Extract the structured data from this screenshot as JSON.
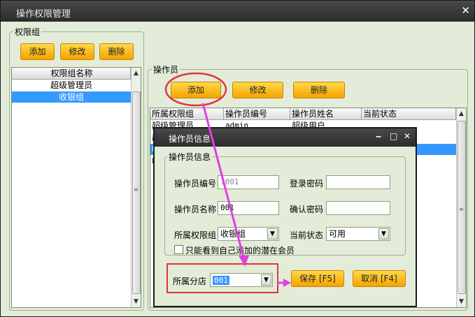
{
  "window": {
    "title": "操作权限管理",
    "close_glyph": "✕"
  },
  "perm_group": {
    "label": "权限组",
    "buttons": {
      "add": "添加",
      "edit": "修改",
      "delete": "删除"
    },
    "column": "权限组名称",
    "rows": [
      "超级管理员",
      "收银组"
    ],
    "selected_index": 1
  },
  "operator": {
    "label": "操作员",
    "buttons": {
      "add": "添加",
      "edit": "修改",
      "delete": "删除"
    },
    "columns": [
      "所属权限组",
      "操作员编号",
      "操作员姓名",
      "当前状态"
    ],
    "rows": [
      {
        "group": "超级管理员",
        "id": "admin",
        "name": "超级用户",
        "status": ""
      },
      {
        "group": "超",
        "id": "",
        "name": "",
        "status": ""
      },
      {
        "group": "收",
        "id": "",
        "name": "",
        "status": ""
      },
      {
        "group": "收",
        "id": "",
        "name": "",
        "status": ""
      }
    ],
    "selected_index": 2
  },
  "dialog": {
    "title": "操作员信息",
    "controls": {
      "minimize": "‒",
      "maximize": "□",
      "close": "✕"
    },
    "group_label": "操作员信息",
    "fields": {
      "op_id_label": "操作员编号",
      "op_id_value": "1001",
      "password_label": "登录密码",
      "password_value": "",
      "op_name_label": "操作员名称",
      "op_name_value": "001",
      "confirm_label": "确认密码",
      "confirm_value": "",
      "perm_group_label": "所属权限组",
      "perm_group_value": "收银组",
      "status_label": "当前状态",
      "status_value": "可用",
      "only_own_label": "只能看到自己添加的潜在会员",
      "only_own_checked": false,
      "branch_label": "所属分店",
      "branch_value": "001"
    },
    "buttons": {
      "save": "保存 [F5]",
      "cancel": "取消 [F4]"
    }
  },
  "annotations": {
    "circle_color": "#e0343a",
    "arrow_color": "#e040e0"
  }
}
